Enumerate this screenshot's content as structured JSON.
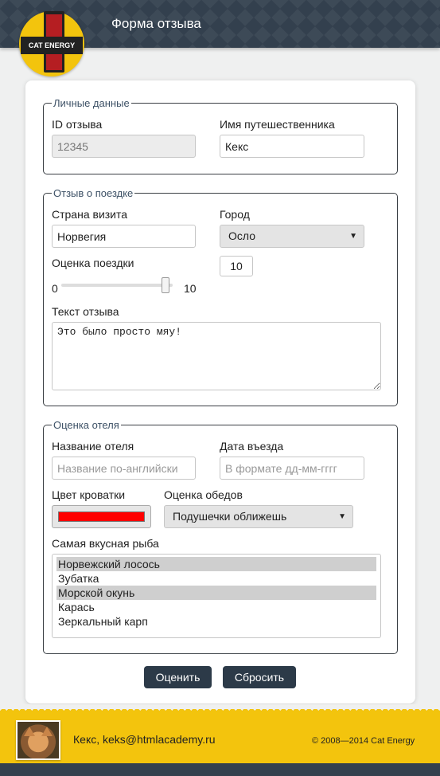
{
  "header": {
    "title": "Форма отзыва",
    "logo_text": "CAT ENERGY"
  },
  "personal": {
    "legend": "Личные данные",
    "id_label": "ID отзыва",
    "id_value": "12345",
    "name_label": "Имя путешественника",
    "name_value": "Кекс"
  },
  "trip": {
    "legend": "Отзыв о поездке",
    "country_label": "Страна визита",
    "country_value": "Норвегия",
    "city_label": "Город",
    "city_value": "Осло",
    "rating_label": "Оценка поездки",
    "rating_min": "0",
    "rating_max": "10",
    "rating_value": "10",
    "rating_fraction": 1.0,
    "review_label": "Текст отзыва",
    "review_text": "Это было просто мяу!"
  },
  "hotel": {
    "legend": "Оценка отеля",
    "hotel_name_label": "Название отеля",
    "hotel_name_placeholder": "Название по-английски",
    "checkin_label": "Дата въезда",
    "checkin_placeholder": "В формате дд-мм-гггг",
    "bed_color_label": "Цвет кроватки",
    "bed_color": "#ff0000",
    "dinner_label": "Оценка обедов",
    "dinner_value": "Подушечки оближешь",
    "fish_label": "Самая вкусная рыба",
    "fish_options": [
      {
        "label": "Норвежский лосось",
        "selected": true
      },
      {
        "label": "Зубатка",
        "selected": false
      },
      {
        "label": "Морской окунь",
        "selected": true
      },
      {
        "label": "Карась",
        "selected": false
      },
      {
        "label": "Зеркальный карп",
        "selected": false
      }
    ]
  },
  "buttons": {
    "submit": "Оценить",
    "reset": "Сбросить"
  },
  "footer": {
    "user": "Кекс, keks@htmlacademy.ru",
    "copyright": "© 2008—2014 Cat Energy"
  },
  "colors": {
    "header_bg": "#33404e",
    "accent_yellow": "#f3c40d",
    "button_bg": "#2c3a48",
    "legend_text": "#3d5166"
  }
}
